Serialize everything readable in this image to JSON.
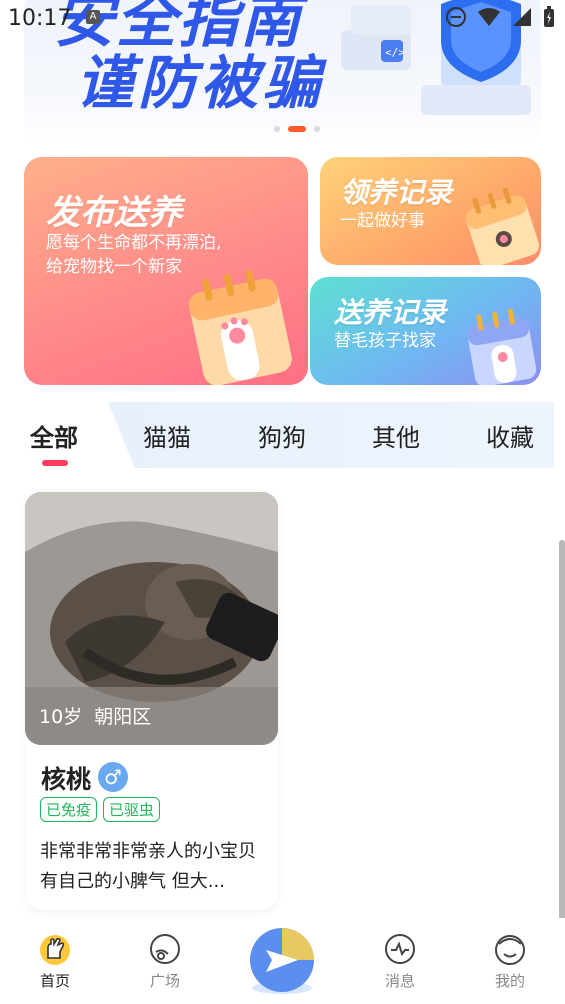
{
  "status_bar": {
    "time": "10:17",
    "badge": "A"
  },
  "banner": {
    "line1": "安全指南",
    "line2": "谨防被骗",
    "slide_count": 3,
    "active_slide": 2
  },
  "cards": {
    "publish": {
      "title": "发布送养",
      "subtitle_line1": "愿每个生命都不再漂泊,",
      "subtitle_line2": "给宠物找一个新家"
    },
    "adopt_record": {
      "title": "领养记录",
      "subtitle": "一起做好事"
    },
    "give_record": {
      "title": "送养记录",
      "subtitle": "替毛孩子找家"
    }
  },
  "tabs": [
    {
      "label": "全部",
      "active": true
    },
    {
      "label": "猫猫",
      "active": false
    },
    {
      "label": "狗狗",
      "active": false
    },
    {
      "label": "其他",
      "active": false
    },
    {
      "label": "收藏",
      "active": false
    }
  ],
  "pets": [
    {
      "age": "10岁",
      "area": "朝阳区",
      "name": "核桃",
      "gender_symbol": "♂",
      "tags": [
        "已免疫",
        "已驱虫"
      ],
      "description": " 非常非常非常亲人的小宝贝 有自己的小脾气 但大..."
    }
  ],
  "bottom_nav": [
    {
      "label": "首页",
      "icon": "home-paw-icon",
      "active": true
    },
    {
      "label": "广场",
      "icon": "square-chat-icon",
      "active": false
    },
    {
      "label": "",
      "icon": "publish-send-icon",
      "active": false
    },
    {
      "label": "消息",
      "icon": "message-icon",
      "active": false
    },
    {
      "label": "我的",
      "icon": "profile-icon",
      "active": false
    }
  ],
  "colors": {
    "brand_blue": "#2f57e8",
    "accent_red": "#ff3b5c",
    "tag_green": "#1fb85a",
    "gender_blue": "#6aa8f0"
  }
}
